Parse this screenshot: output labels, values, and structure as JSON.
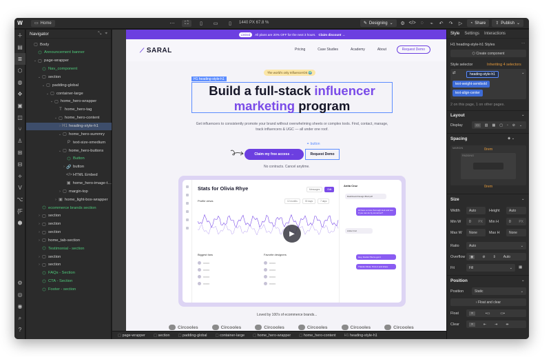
{
  "topbar": {
    "home_label": "Home",
    "size_readout": "1440 PX  67.8 %",
    "mode_label": "Designing",
    "share_label": "Share",
    "publish_label": "Publish"
  },
  "navigator": {
    "title": "Navigator",
    "items": [
      {
        "label": "Body",
        "icon": "▢",
        "indent": 0,
        "caret": "",
        "green": false,
        "selected": false
      },
      {
        "label": "Announcement banner",
        "icon": "⬡",
        "indent": 1,
        "caret": "",
        "green": true,
        "selected": false
      },
      {
        "label": "page-wrapper",
        "icon": "▢",
        "indent": 1,
        "caret": "⌄",
        "green": false,
        "selected": false
      },
      {
        "label": "Nav_component",
        "icon": "⬡",
        "indent": 2,
        "caret": "",
        "green": true,
        "selected": false
      },
      {
        "label": "section",
        "icon": "▢",
        "indent": 2,
        "caret": "⌄",
        "green": false,
        "selected": false
      },
      {
        "label": "padding-global",
        "icon": "▢",
        "indent": 3,
        "caret": "⌄",
        "green": false,
        "selected": false
      },
      {
        "label": "container-large",
        "icon": "▢",
        "indent": 4,
        "caret": "⌄",
        "green": false,
        "selected": false
      },
      {
        "label": "home_hero-wrapper",
        "icon": "▢",
        "indent": 5,
        "caret": "⌄",
        "green": false,
        "selected": false
      },
      {
        "label": "home_hero-tag",
        "icon": "T",
        "indent": 6,
        "caret": "",
        "green": false,
        "selected": false
      },
      {
        "label": "home_hero-content",
        "icon": "▢",
        "indent": 6,
        "caret": "⌄",
        "green": false,
        "selected": false
      },
      {
        "label": "heading-style-h1",
        "icon": "H1",
        "indent": 7,
        "caret": "›",
        "green": false,
        "selected": true
      },
      {
        "label": "home_hero-summry",
        "icon": "▢",
        "indent": 7,
        "caret": "⌄",
        "green": false,
        "selected": false
      },
      {
        "label": "text-size-xmedium",
        "icon": "P",
        "indent": 8,
        "caret": "",
        "green": false,
        "selected": false
      },
      {
        "label": "home_hero-buttons",
        "icon": "▢",
        "indent": 7,
        "caret": "⌄",
        "green": false,
        "selected": false
      },
      {
        "label": "Button",
        "icon": "⬡",
        "indent": 8,
        "caret": "",
        "green": true,
        "selected": false
      },
      {
        "label": "button",
        "icon": "🔗",
        "indent": 8,
        "caret": "›",
        "green": false,
        "selected": false
      },
      {
        "label": "HTML Embed",
        "icon": "</>",
        "indent": 8,
        "caret": "",
        "green": false,
        "selected": false
      },
      {
        "label": "home_hero-image-t…",
        "icon": "▣",
        "indent": 8,
        "caret": "",
        "green": false,
        "selected": false
      },
      {
        "label": "margin-top",
        "icon": "▢",
        "indent": 7,
        "caret": "›",
        "green": false,
        "selected": false
      },
      {
        "label": "home_light-box-wrapper",
        "icon": "▣",
        "indent": 6,
        "caret": "›",
        "green": false,
        "selected": false
      },
      {
        "label": "ecommerce brands section",
        "icon": "⬡",
        "indent": 2,
        "caret": "",
        "green": true,
        "selected": false
      },
      {
        "label": "section",
        "icon": "▢",
        "indent": 2,
        "caret": "›",
        "green": false,
        "selected": false
      },
      {
        "label": "section",
        "icon": "▢",
        "indent": 2,
        "caret": "›",
        "green": false,
        "selected": false
      },
      {
        "label": "section",
        "icon": "▢",
        "indent": 2,
        "caret": "›",
        "green": false,
        "selected": false
      },
      {
        "label": "home_tab-section",
        "icon": "▢",
        "indent": 2,
        "caret": "›",
        "green": false,
        "selected": false
      },
      {
        "label": "Testimonial - section",
        "icon": "⬡",
        "indent": 2,
        "caret": "",
        "green": true,
        "selected": false
      },
      {
        "label": "section",
        "icon": "▢",
        "indent": 2,
        "caret": "›",
        "green": false,
        "selected": false
      },
      {
        "label": "section",
        "icon": "▢",
        "indent": 2,
        "caret": "›",
        "green": false,
        "selected": false
      },
      {
        "label": "FAQs - Section",
        "icon": "⬡",
        "indent": 2,
        "caret": "",
        "green": true,
        "selected": false
      },
      {
        "label": "CTA - Section",
        "icon": "⬡",
        "indent": 2,
        "caret": "",
        "green": true,
        "selected": false
      },
      {
        "label": "Footer - section",
        "icon": "⬡",
        "indent": 2,
        "caret": "",
        "green": true,
        "selected": false
      }
    ]
  },
  "site": {
    "banner": {
      "tag": "Limited",
      "text": "All plans are 20% OFF for the next 3 hours.",
      "cta": "Claim discount →"
    },
    "brand": "SARAL",
    "nav_links": [
      "Pricing",
      "Case Studies",
      "Academy",
      "About"
    ],
    "nav_cta": "Request Demo",
    "hero_tag": "The world's only InfluencerOS 🌍",
    "selected_label": "H1  heading-style-h1",
    "h1_line1_a": "Build a full-stack ",
    "h1_line1_b": "influencer",
    "h1_line2_a": "marketing",
    "h1_line2_b": " program",
    "subtitle": "Get influencers to consistently promote your brand without overwhelming sheets or complex tools. Find, contact, manage, track influencers & UGC — all under one roof.",
    "button_label": "⚭ button",
    "primary_cta": "Claim my free access  →",
    "secondary_cta": "Request Demo",
    "no_contracts": "No contracts. Cancel anytime.",
    "loved_by": "Loved by 100's of ecommerce brands...",
    "brand_logos": [
      "Circooles",
      "Circooles",
      "Circooles",
      "Circooles",
      "Circooles",
      "Circooles"
    ]
  },
  "dashboard": {
    "title": "Stats for Olivia Rhye",
    "tabs": [
      "Messages",
      "Edit"
    ],
    "profile_views": "Profile views",
    "range_tabs": [
      "12 months",
      "30 days",
      "7 days"
    ],
    "biggest_fans": "Biggest fans",
    "favorite_designers": "Favorite designers",
    "chat_name": "Anita Cruz",
    "chat_bubbles": [
      "Dashboard Design Brief.pdf",
      "Hi have a more thorough look and see if you can do by tomorrow?",
      "Anita Cruz",
      "Hey, thanks! We've got it",
      "Thanks Olivia, I'll do it and share"
    ]
  },
  "right_panel": {
    "tabs": [
      "Style",
      "Settings",
      "Interactions"
    ],
    "styles_for": "H1  heading-style-h1 Styles",
    "create_component": "Create component",
    "selector_label": "Style selector",
    "inheriting": "Inheriting 4 selectors",
    "classes": [
      "heading-style-h1",
      "text-weight-semibold",
      "text-align-center"
    ],
    "on_page": "2 on this page, 1 on other pages.",
    "layout_head": "Layout",
    "display_label": "Display",
    "spacing_head": "Spacing",
    "margin_label": "MARGIN",
    "padding_label": "PADDING",
    "margin_top": "0rem",
    "margin_bottom": "0rem",
    "size_head": "Size",
    "width_label": "Width",
    "width_val": "Auto",
    "height_label": "Height",
    "height_val": "Auto",
    "minw_label": "Min W",
    "minw_val": "0",
    "minh_label": "Min H",
    "minh_val": "0",
    "maxw_label": "Max W",
    "maxw_val": "None",
    "maxh_label": "Max H",
    "maxh_val": "None",
    "px": "PX",
    "ratio_label": "Ratio",
    "ratio_val": "Auto",
    "overflow_label": "Overflow",
    "overflow_auto": "Auto",
    "fit_label": "Fit",
    "fit_val": "Fill",
    "position_head": "Position",
    "position_label": "Position",
    "position_val": "Static",
    "float_clear": "Float and clear",
    "float_label": "Float",
    "clear_label": "Clear"
  },
  "breadcrumbs": [
    "page-wrapper",
    "section",
    "padding-global",
    "container-large",
    "home_hero-wrapper",
    "home_hero-content",
    "heading-style-h1"
  ],
  "colors": {
    "accent": "#6c3fe0",
    "selection": "#5b8cff",
    "component_green": "#4fca7b"
  }
}
